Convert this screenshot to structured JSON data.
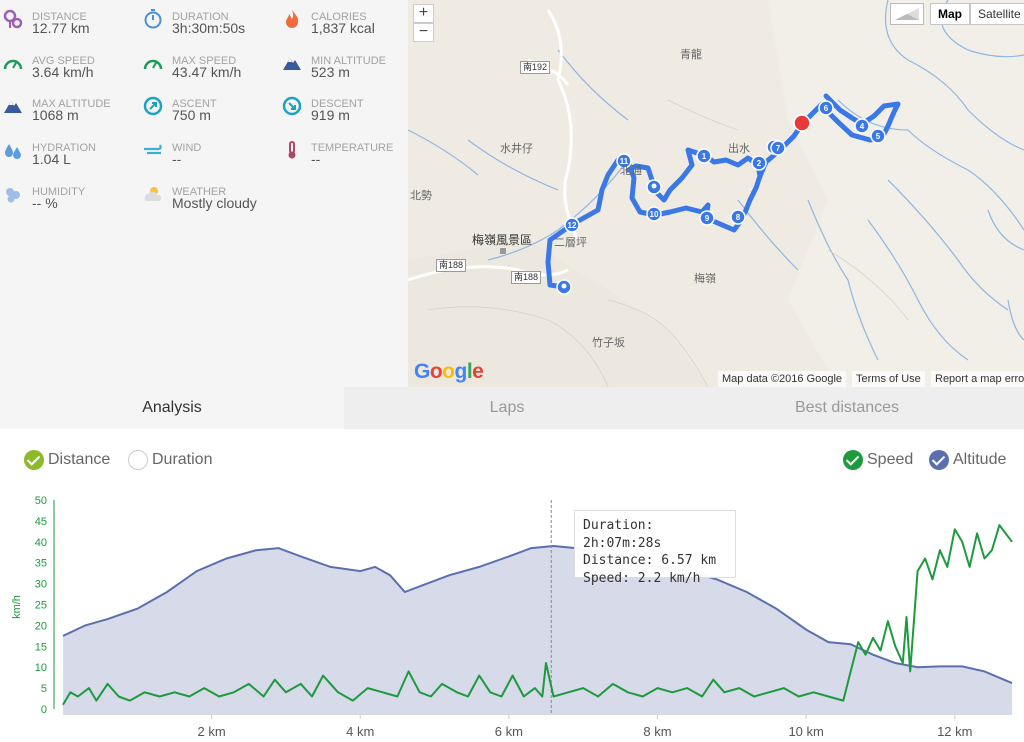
{
  "stats": [
    {
      "label": "DISTANCE",
      "value": "12.77 km",
      "icon": "route-pin-icon",
      "color": "#9c5fb5"
    },
    {
      "label": "DURATION",
      "value": "3h:30m:50s",
      "icon": "stopwatch-icon",
      "color": "#4a90d9"
    },
    {
      "label": "CALORIES",
      "value": "1,837 kcal",
      "icon": "flame-icon",
      "color": "#f06a3c"
    },
    {
      "label": "AVG SPEED",
      "value": "3.64 km/h",
      "icon": "speedometer-icon",
      "color": "#1e9a5a"
    },
    {
      "label": "MAX SPEED",
      "value": "43.47 km/h",
      "icon": "speedometer-icon",
      "color": "#1e9a5a"
    },
    {
      "label": "MIN ALTITUDE",
      "value": "523 m",
      "icon": "mountain-icon",
      "color": "#3a5a9c"
    },
    {
      "label": "MAX ALTITUDE",
      "value": "1068 m",
      "icon": "mountain-icon",
      "color": "#3a5a9c"
    },
    {
      "label": "ASCENT",
      "value": "750 m",
      "icon": "ascent-gauge-icon",
      "color": "#1aa3c0"
    },
    {
      "label": "DESCENT",
      "value": "919 m",
      "icon": "descent-gauge-icon",
      "color": "#1aa3c0"
    },
    {
      "label": "HYDRATION",
      "value": "1.04 L",
      "icon": "water-drops-icon",
      "color": "#5b9ee0"
    },
    {
      "label": "WIND",
      "value": "--",
      "icon": "wind-icon",
      "color": "#3bb0d6"
    },
    {
      "label": "TEMPERATURE",
      "value": "--",
      "icon": "thermometer-icon",
      "color": "#b0456a"
    },
    {
      "label": "HUMIDITY",
      "value": "-- %",
      "icon": "humidity-icon",
      "color": "#9fbde8"
    },
    {
      "label": "WEATHER",
      "value": "Mostly cloudy",
      "icon": "partly-cloudy-icon",
      "color": "#f5c542"
    }
  ],
  "map": {
    "zoom_in": "+",
    "zoom_out": "−",
    "type_map": "Map",
    "type_satellite": "Satellite",
    "google_logo": "Google",
    "attribution": "Map data ©2016 Google",
    "terms": "Terms of Use",
    "report": "Report a map error",
    "places": [
      "青龍",
      "水井仔",
      "出水",
      "梅嶺風景區",
      "北勢",
      "二層坪",
      "梅嶺",
      "竹子坂",
      "北通"
    ],
    "roads": [
      "南192",
      "南188",
      "南188"
    ],
    "laps": [
      "1",
      "2",
      "3",
      "4",
      "5",
      "6",
      "7",
      "8",
      "9",
      "10",
      "11",
      "12"
    ],
    "route_color": "#3b78e7",
    "end_color": "#e83a3a"
  },
  "tabs": [
    {
      "label": "Analysis",
      "active": true
    },
    {
      "label": "Laps",
      "active": false
    },
    {
      "label": "Best distances",
      "active": false
    }
  ],
  "legend": {
    "distance": "Distance",
    "duration": "Duration",
    "speed": "Speed",
    "altitude": "Altitude"
  },
  "tooltip": {
    "duration": "Duration: 2h:07m:28s",
    "distance": "Distance: 6.57 km",
    "speed": "Speed: 2.2 km/h"
  },
  "chart_data": {
    "type": "line",
    "ylabel": "km/h",
    "ylim": [
      0,
      50
    ],
    "yticks": [
      "0",
      "5",
      "10",
      "15",
      "20",
      "25",
      "30",
      "35",
      "40",
      "45",
      "50"
    ],
    "xlim": [
      0,
      12.77
    ],
    "xticks": [
      {
        "v": 2,
        "label": "2 km"
      },
      {
        "v": 4,
        "label": "4 km"
      },
      {
        "v": 6,
        "label": "6 km"
      },
      {
        "v": 8,
        "label": "8 km"
      },
      {
        "v": 10,
        "label": "10 km"
      },
      {
        "v": 12,
        "label": "12 km"
      }
    ],
    "cursor_x": 6.57,
    "series": [
      {
        "name": "Altitude",
        "color": "#5b6fad",
        "fill": "#d6dae9",
        "x": [
          0,
          0.3,
          0.6,
          1.0,
          1.4,
          1.8,
          2.2,
          2.6,
          2.9,
          3.2,
          3.6,
          4.0,
          4.2,
          4.4,
          4.6,
          4.9,
          5.2,
          5.6,
          6.0,
          6.3,
          6.6,
          6.9,
          7.2,
          7.6,
          8.0,
          8.4,
          8.8,
          9.2,
          9.6,
          10.0,
          10.3,
          10.6,
          10.9,
          11.2,
          11.5,
          11.8,
          12.1,
          12.4,
          12.77
        ],
        "y": [
          17.5,
          20,
          21.5,
          24,
          28,
          33,
          36,
          38,
          38.5,
          36.5,
          34,
          33,
          34,
          32,
          28,
          30,
          32,
          34,
          36.5,
          38.5,
          39,
          38.5,
          37,
          35,
          34,
          33,
          31,
          28,
          24,
          19,
          16,
          15.5,
          13,
          11,
          10,
          10.2,
          10.2,
          9,
          6.2
        ]
      },
      {
        "name": "Speed",
        "color": "#1e9a3e",
        "x": [
          0,
          0.1,
          0.2,
          0.35,
          0.45,
          0.6,
          0.75,
          0.9,
          1.1,
          1.3,
          1.5,
          1.7,
          1.9,
          2.1,
          2.3,
          2.5,
          2.7,
          2.85,
          3.0,
          3.2,
          3.35,
          3.5,
          3.7,
          3.9,
          4.1,
          4.3,
          4.5,
          4.65,
          4.8,
          4.95,
          5.1,
          5.3,
          5.45,
          5.6,
          5.75,
          5.9,
          6.05,
          6.2,
          6.35,
          6.45,
          6.5,
          6.6,
          6.8,
          7.0,
          7.2,
          7.4,
          7.6,
          7.8,
          8.0,
          8.2,
          8.4,
          8.6,
          8.75,
          8.9,
          9.1,
          9.3,
          9.5,
          9.7,
          9.9,
          10.1,
          10.3,
          10.5,
          10.6,
          10.7,
          10.8,
          10.9,
          11.0,
          11.1,
          11.2,
          11.3,
          11.35,
          11.4,
          11.5,
          11.6,
          11.7,
          11.8,
          11.9,
          12.0,
          12.1,
          12.2,
          12.3,
          12.4,
          12.5,
          12.6,
          12.77
        ],
        "y": [
          1,
          4,
          3,
          5,
          2,
          6,
          3,
          2,
          4,
          3,
          4,
          3,
          5,
          3,
          4,
          6,
          3,
          7,
          4,
          6,
          3,
          8,
          4,
          2,
          5,
          4,
          3,
          9,
          4,
          3,
          6,
          4,
          3,
          8,
          4,
          3,
          8,
          3,
          5,
          3,
          11,
          3,
          4,
          5,
          3,
          6,
          4,
          3,
          5,
          4,
          5,
          3,
          7,
          4,
          5,
          3,
          4,
          5,
          3,
          4,
          3,
          2,
          9,
          16,
          13,
          17,
          14,
          21,
          15,
          11,
          22,
          9,
          33,
          36,
          31,
          38,
          34,
          43,
          40,
          34,
          42,
          36,
          38,
          44,
          40
        ]
      }
    ]
  }
}
